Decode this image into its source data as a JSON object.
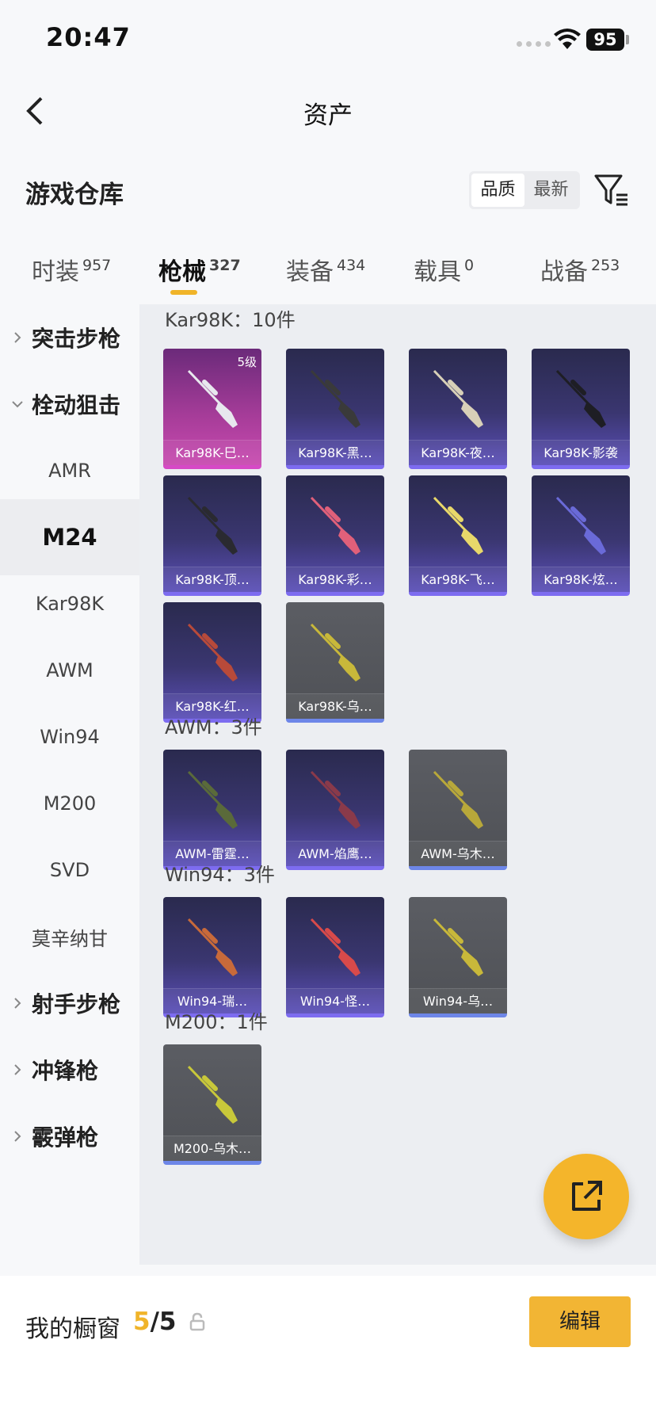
{
  "status_bar": {
    "time": "20:47",
    "battery": "95"
  },
  "nav": {
    "title": "资产"
  },
  "warehouse": {
    "title": "游戏仓库",
    "sort_options": [
      "品质",
      "最新"
    ],
    "active_sort": "品质"
  },
  "tabs": [
    {
      "label": "时装",
      "count": "957"
    },
    {
      "label": "枪械",
      "count": "327"
    },
    {
      "label": "装备",
      "count": "434"
    },
    {
      "label": "载具",
      "count": "0"
    },
    {
      "label": "战备",
      "count": "253"
    }
  ],
  "active_tab": "枪械",
  "sidebar": [
    {
      "label": "突击步枪",
      "type": "group"
    },
    {
      "label": "栓动狙击",
      "type": "group-open"
    },
    {
      "label": "AMR",
      "type": "item"
    },
    {
      "label": "M24",
      "type": "item-active"
    },
    {
      "label": "Kar98K",
      "type": "item"
    },
    {
      "label": "AWM",
      "type": "item"
    },
    {
      "label": "Win94",
      "type": "item"
    },
    {
      "label": "M200",
      "type": "item"
    },
    {
      "label": "SVD",
      "type": "item"
    },
    {
      "label": "莫辛纳甘",
      "type": "item"
    },
    {
      "label": "射手步枪",
      "type": "group"
    },
    {
      "label": "冲锋枪",
      "type": "group"
    },
    {
      "label": "霰弹枪",
      "type": "group"
    }
  ],
  "sections": [
    {
      "title": "Kar98K：10件",
      "items": [
        {
          "name": "Kar98K-巳…",
          "rarity": "legend",
          "level": "5级",
          "color": "#e8e8ee"
        },
        {
          "name": "Kar98K-黑…",
          "rarity": "epic",
          "color": "#3a3a3a"
        },
        {
          "name": "Kar98K-夜…",
          "rarity": "epic",
          "color": "#d8d0b8"
        },
        {
          "name": "Kar98K-影袭",
          "rarity": "epic",
          "color": "#1e1e24"
        },
        {
          "name": "Kar98K-顶…",
          "rarity": "epic",
          "color": "#2a2a30"
        },
        {
          "name": "Kar98K-彩…",
          "rarity": "epic",
          "color": "#e0607a"
        },
        {
          "name": "Kar98K-飞…",
          "rarity": "epic",
          "color": "#e8d86a"
        },
        {
          "name": "Kar98K-炫…",
          "rarity": "epic",
          "color": "#6a6ad8"
        },
        {
          "name": "Kar98K-红…",
          "rarity": "epic",
          "color": "#b84a3a"
        },
        {
          "name": "Kar98K-乌…",
          "rarity": "normal",
          "color": "#c8b83a"
        }
      ]
    },
    {
      "title": "AWM：3件",
      "items": [
        {
          "name": "AWM-雷霆…",
          "rarity": "epic",
          "color": "#5a6a3a"
        },
        {
          "name": "AWM-焰鹰…",
          "rarity": "epic",
          "color": "#8a3a4a"
        },
        {
          "name": "AWM-乌木…",
          "rarity": "normal",
          "color": "#b8a83a"
        }
      ]
    },
    {
      "title": "Win94：3件",
      "items": [
        {
          "name": "Win94-瑞…",
          "rarity": "epic",
          "color": "#c86a3a"
        },
        {
          "name": "Win94-怪…",
          "rarity": "epic",
          "color": "#d84a4a"
        },
        {
          "name": "Win94-乌…",
          "rarity": "normal",
          "color": "#c8b83a"
        }
      ]
    },
    {
      "title": "M200：1件",
      "items": [
        {
          "name": "M200-乌木…",
          "rarity": "normal",
          "color": "#c8c83a"
        }
      ]
    }
  ],
  "bottom": {
    "label": "我的橱窗",
    "count_current": "5",
    "count_total": "/5",
    "edit_label": "编辑"
  },
  "colors": {
    "accent": "#f2b534",
    "legend": "#d64ac6",
    "epic": "#7d6cf0",
    "normal": "#6d86e8"
  }
}
